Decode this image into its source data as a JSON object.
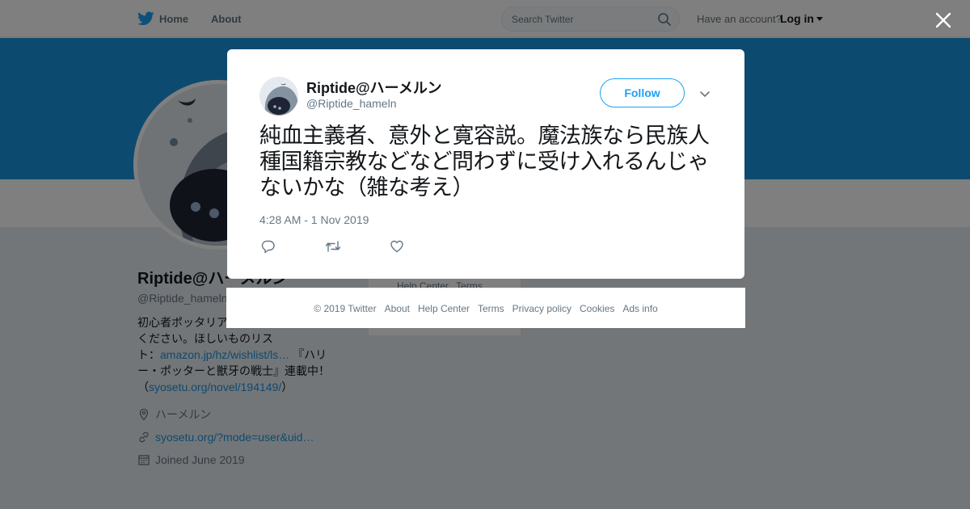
{
  "nav": {
    "home_label": "Home",
    "about_label": "About",
    "search_placeholder": "Search Twitter",
    "account_prompt": "Have an account?",
    "login_label": "Log in"
  },
  "profile": {
    "name": "Riptide@ハーメルン",
    "handle": "@Riptide_hameln",
    "bio_part1": "初心者ポッタリア",
    "bio_part2": "ください。ほしいものリス",
    "bio_part3": "ト：",
    "bio_link1": "amazon.jp/hz/wishlist/ls…",
    "bio_part4": "『ハリ",
    "bio_part5": "ー・ポッターと獣牙の戦士』連載中！",
    "bio_part6": "（",
    "bio_link2": "syosetu.org/novel/194149/",
    "bio_part7": "）",
    "location": "ハーメルン",
    "website": "syosetu.org/?mode=user&uid…",
    "joined": "Joined June 2019"
  },
  "side_card": {
    "links": [
      "Help Center",
      "Terms"
    ]
  },
  "tweet": {
    "author_name": "Riptide@ハーメルン",
    "author_handle": "@Riptide_hameln",
    "follow_label": "Follow",
    "text": "純血主義者、意外と寛容説。魔法族なら民族人種国籍宗教などなど問わずに受け入れるんじゃないかな（雑な考え）",
    "timestamp": "4:28 AM - 1 Nov 2019"
  },
  "footer": {
    "links": [
      "© 2019 Twitter",
      "About",
      "Help Center",
      "Terms",
      "Privacy policy",
      "Cookies",
      "Ads info"
    ]
  },
  "colors": {
    "accent": "#1da1f2",
    "banner": "#1b95e0",
    "overlay": "rgba(0,0,0,0.5)"
  },
  "icons": [
    "twitter-bird-icon",
    "search-icon",
    "close-icon",
    "chevron-down-icon",
    "reply-icon",
    "retweet-icon",
    "like-icon",
    "location-icon",
    "link-icon",
    "calendar-icon"
  ]
}
